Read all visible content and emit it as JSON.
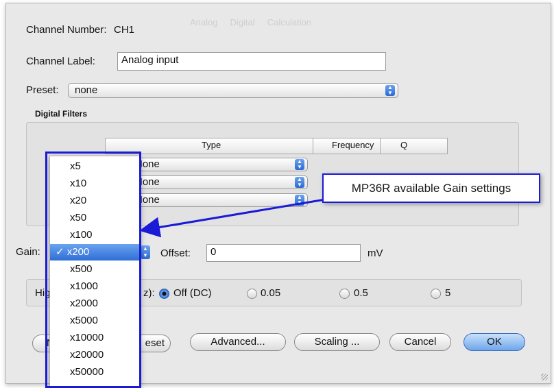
{
  "channel_number": {
    "label": "Channel Number:",
    "value": "CH1"
  },
  "channel_label": {
    "label": "Channel Label:",
    "value": "Analog input"
  },
  "preset": {
    "label": "Preset:",
    "value": "none"
  },
  "digital_filters": {
    "title": "Digital Filters",
    "columns": [
      "Type",
      "Frequency",
      "Q"
    ],
    "rows": [
      {
        "type": "None"
      },
      {
        "type": "None"
      },
      {
        "type": "None"
      }
    ]
  },
  "gain": {
    "label": "Gain:",
    "selected": "x200",
    "options": [
      "x5",
      "x10",
      "x20",
      "x50",
      "x100",
      "x200",
      "x500",
      "x1000",
      "x2000",
      "x5000",
      "x10000",
      "x20000",
      "x50000"
    ]
  },
  "offset": {
    "label": "Offset:",
    "value": "0",
    "unit": "mV"
  },
  "highpass": {
    "label_visible": "Hig",
    "label_tail": "z):",
    "options": [
      {
        "label": "Off (DC)",
        "selected": true
      },
      {
        "label": "0.05"
      },
      {
        "label": "0.5"
      },
      {
        "label": "5"
      }
    ]
  },
  "buttons": {
    "left_fragment": "N",
    "reset_fragment": "eset",
    "advanced": "Advanced...",
    "scaling": "Scaling ...",
    "cancel": "Cancel",
    "ok": "OK"
  },
  "callout": {
    "text": "MP36R available Gain settings"
  },
  "colors": {
    "highlight": "#2f6dd6",
    "annotation": "#1b1bd6"
  }
}
